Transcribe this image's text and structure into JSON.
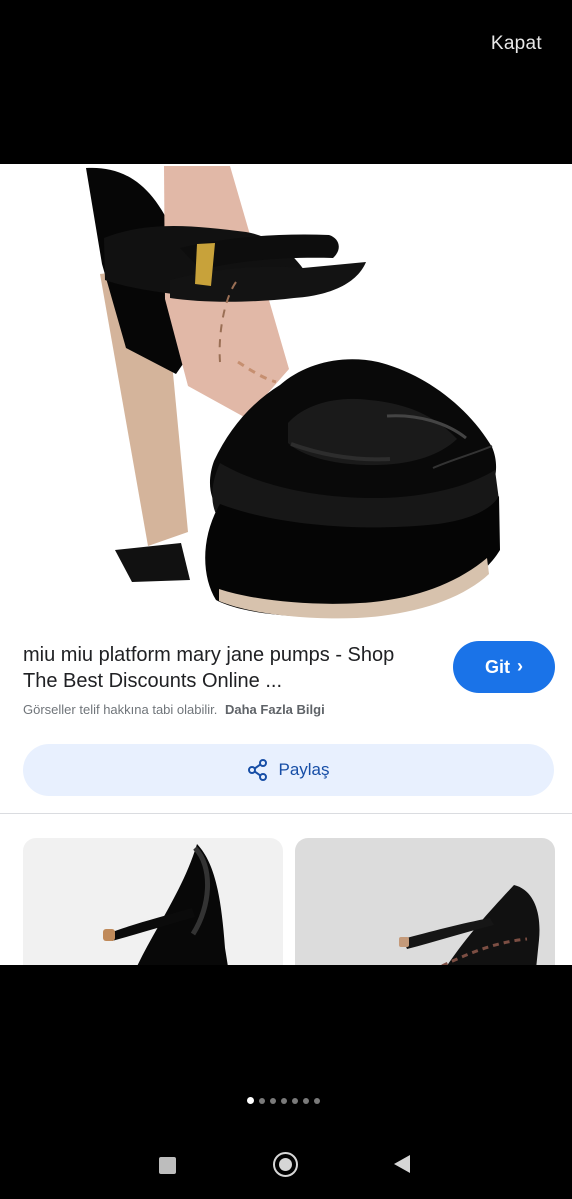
{
  "header": {
    "close_label": "Kapat"
  },
  "result": {
    "title": "miu miu platform mary jane pumps - Shop The Best Discounts Online ...",
    "go_label": "Git",
    "copyright_notice": "Görseller telif hakkına tabi olabilir.",
    "more_info": "Daha Fazla Bilgi",
    "share_label": "Paylaş"
  },
  "pagination": {
    "pages": 7,
    "active": 1
  },
  "colors": {
    "primary_blue": "#1a73e8",
    "share_bg": "#e8f0fe",
    "share_text": "#174ea6",
    "background": "#000000"
  }
}
